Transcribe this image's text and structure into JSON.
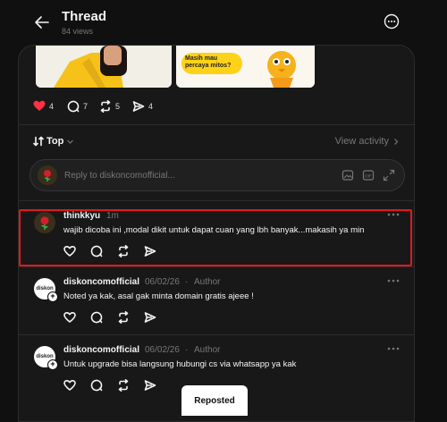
{
  "header": {
    "title": "Thread",
    "views": "84 views"
  },
  "post": {
    "image_right_text_line1": "Masih mau",
    "image_right_text_line2": "percaya mitos?",
    "actions": {
      "likes": "4",
      "comments": "7",
      "reposts": "5",
      "shares": "4"
    }
  },
  "sort": {
    "label": "Top",
    "view_activity": "View activity"
  },
  "reply": {
    "placeholder": "Reply to diskoncomofficial..."
  },
  "comments": [
    {
      "username": "thinkkyu",
      "time": "1m",
      "author_tag": "",
      "text": "wajib dicoba ini ,modal dikit untuk dapat cuan yang lbh banyak...makasih ya min",
      "avatar_text": ""
    },
    {
      "username": "diskoncomofficial",
      "time": "06/02/26",
      "author_tag": "Author",
      "text": "Noted ya kak, asal gak minta domain gratis ajeee !",
      "avatar_text": "diskon"
    },
    {
      "username": "diskoncomofficial",
      "time": "06/02/26",
      "author_tag": "Author",
      "text": "Untuk upgrade bisa langsung hubungi cs via whatsapp ya kak",
      "avatar_text": "diskon"
    }
  ],
  "toast": {
    "label": "Reposted"
  },
  "colors": {
    "background": "#101010",
    "panel": "#181818",
    "like_red": "#ff3040",
    "highlight_border": "#e0191f",
    "muted_text": "#777777"
  }
}
